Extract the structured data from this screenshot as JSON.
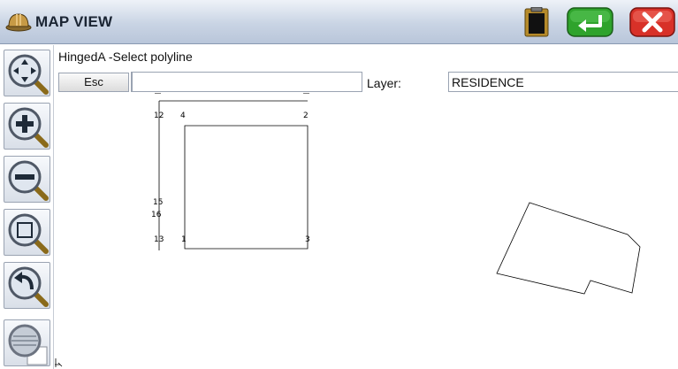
{
  "titlebar": {
    "title": "MAP VIEW",
    "app_icon": "hardhat-icon",
    "buttons": [
      {
        "name": "clipboard-icon"
      },
      {
        "name": "enter-icon",
        "color": "#2fa32c"
      },
      {
        "name": "close-icon",
        "color": "#d83128"
      }
    ]
  },
  "toolbar": {
    "tools": [
      "pan-zoom-icon",
      "zoom-in-icon",
      "zoom-out-icon",
      "zoom-window-icon",
      "zoom-previous-icon",
      "zoom-layer-icon"
    ]
  },
  "command": {
    "prompt": "HingedA -Select polyline",
    "esc_label": "Esc",
    "input_value": "",
    "layer_label": "Layer:",
    "layer_value": "RESIDENCE"
  },
  "map": {
    "point_labels": [
      "12",
      "4",
      "2",
      "15",
      "16",
      "13",
      "1",
      "3"
    ]
  }
}
